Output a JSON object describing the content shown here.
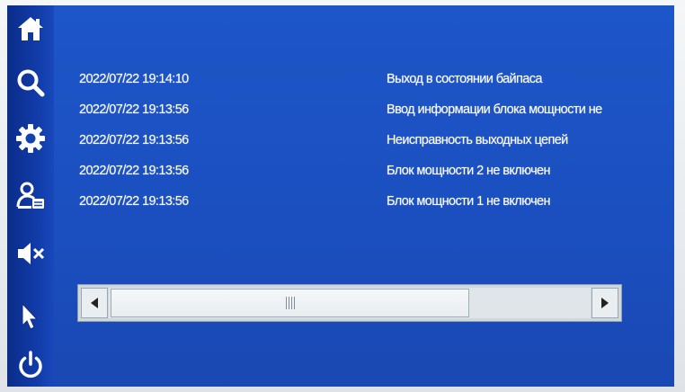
{
  "sidebar": {
    "items": [
      {
        "icon": "home-icon"
      },
      {
        "icon": "search-icon"
      },
      {
        "icon": "gear-icon"
      },
      {
        "icon": "user-card-icon"
      },
      {
        "icon": "mute-icon"
      },
      {
        "icon": "pointer-icon"
      },
      {
        "icon": "power-icon"
      }
    ]
  },
  "log": {
    "rows": [
      {
        "time": "2022/07/22 19:14:10",
        "message": "Выход в состоянии байпаса"
      },
      {
        "time": "2022/07/22 19:13:56",
        "message": "Ввод информации блока мощности не"
      },
      {
        "time": "2022/07/22 19:13:56",
        "message": "Неисправность выходных цепей"
      },
      {
        "time": "2022/07/22 19:13:56",
        "message": "Блок мощности 2 не включен"
      },
      {
        "time": "2022/07/22 19:13:56",
        "message": "Блок мощности 1 не включен"
      }
    ]
  },
  "scrollbar": {
    "position": 0,
    "visible_fraction": 0.75
  },
  "colors": {
    "screen_bg": "#1d56c9",
    "sidebar_bg": "#0b2d8a",
    "text": "#ffffff",
    "scrollbar": "#dfe5e9"
  }
}
